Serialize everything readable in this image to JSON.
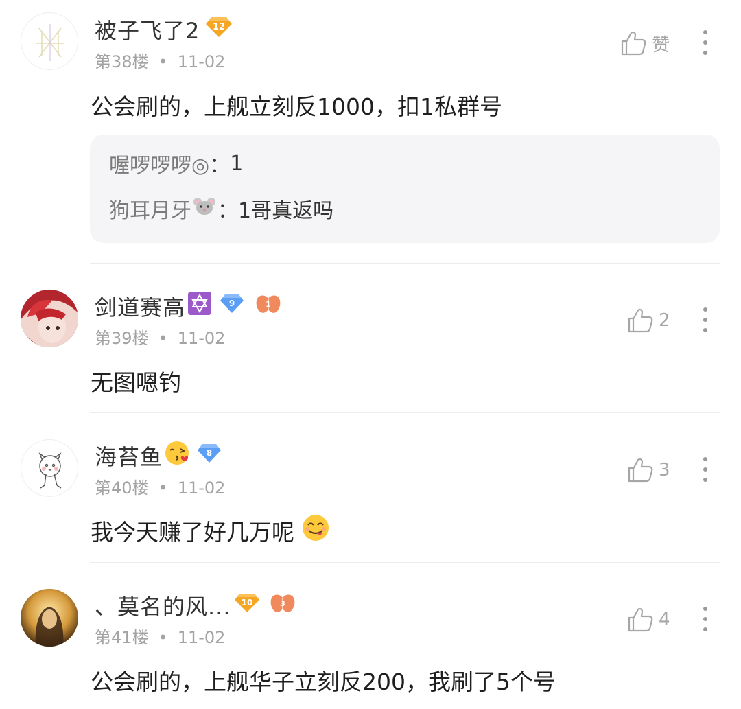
{
  "comments": [
    {
      "username": "被子飞了2",
      "level": "12",
      "floor": "第38楼",
      "sep": "•",
      "date": "11-02",
      "like_label": "赞",
      "text": "公会刷的，上舰立刻反1000，扣1私群号",
      "replies": [
        {
          "name": "喔啰啰啰◎",
          "colon": "：",
          "text": "1"
        },
        {
          "name": "狗耳月牙",
          "colon": "：",
          "text": "1哥真返吗"
        }
      ]
    },
    {
      "username": "剑道赛高",
      "level": "9",
      "fan_level": "1",
      "floor": "第39楼",
      "sep": "•",
      "date": "11-02",
      "likes": "2",
      "text": "无图嗯钓"
    },
    {
      "username": "海苔鱼",
      "level": "8",
      "floor": "第40楼",
      "sep": "•",
      "date": "11-02",
      "likes": "3",
      "text": "我今天赚了好几万呢"
    },
    {
      "username": "、莫名的风...",
      "level": "10",
      "fan_level": "3",
      "floor": "第41楼",
      "sep": "•",
      "date": "11-02",
      "likes": "4",
      "text": "公会刷的，上舰华子立刻反200，我刷了5个号"
    }
  ],
  "colors": {
    "gold_badge": "#f5a623",
    "blue_badge": "#5b9ef5",
    "fan_badge": "#f08a5d",
    "reply_bg": "#f5f5f7",
    "meta_text": "#a3a3a3"
  }
}
